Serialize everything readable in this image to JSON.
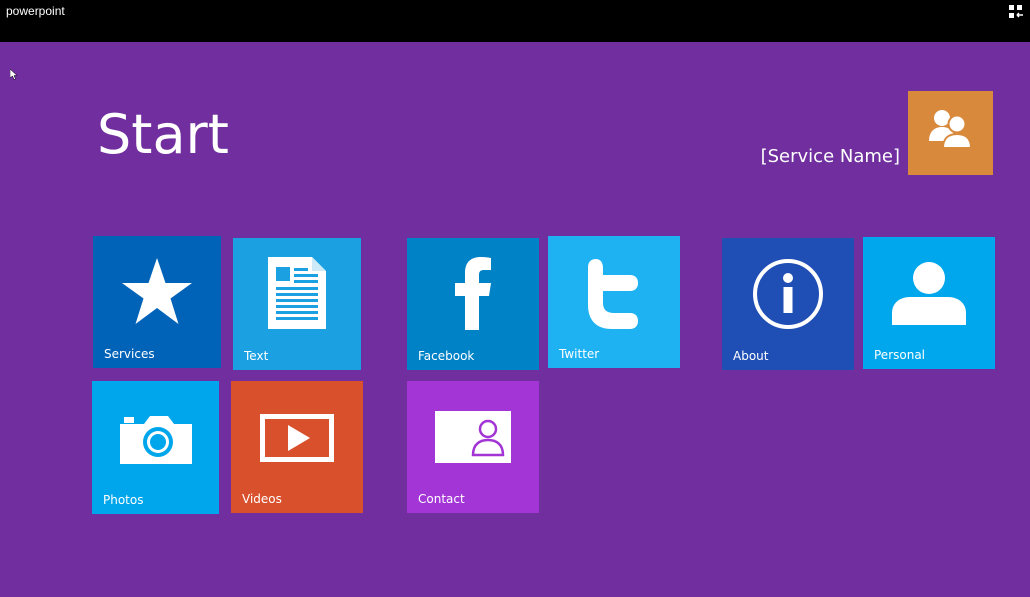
{
  "window": {
    "title": "powerpoint"
  },
  "header": {
    "title": "Start",
    "user_name": "[Service Name]"
  },
  "tiles": [
    {
      "label": "Services",
      "icon": "star-icon",
      "color": "#0063b8"
    },
    {
      "label": "Text",
      "icon": "document-icon",
      "color": "#1ba1e2"
    },
    {
      "label": "Facebook",
      "icon": "facebook-icon",
      "color": "#0082c7"
    },
    {
      "label": "Twitter",
      "icon": "twitter-icon",
      "color": "#1fb2f2"
    },
    {
      "label": "About",
      "icon": "info-icon",
      "color": "#1f4fb5"
    },
    {
      "label": "Personal",
      "icon": "person-icon",
      "color": "#00a7ec"
    },
    {
      "label": "Photos",
      "icon": "camera-icon",
      "color": "#00a6ec"
    },
    {
      "label": "Videos",
      "icon": "play-icon",
      "color": "#d9512c"
    },
    {
      "label": "Contact",
      "icon": "contact-card-icon",
      "color": "#a335d6"
    }
  ],
  "colors": {
    "background": "#702e9e",
    "titlebar": "#000000",
    "avatar": "#d8893b"
  }
}
